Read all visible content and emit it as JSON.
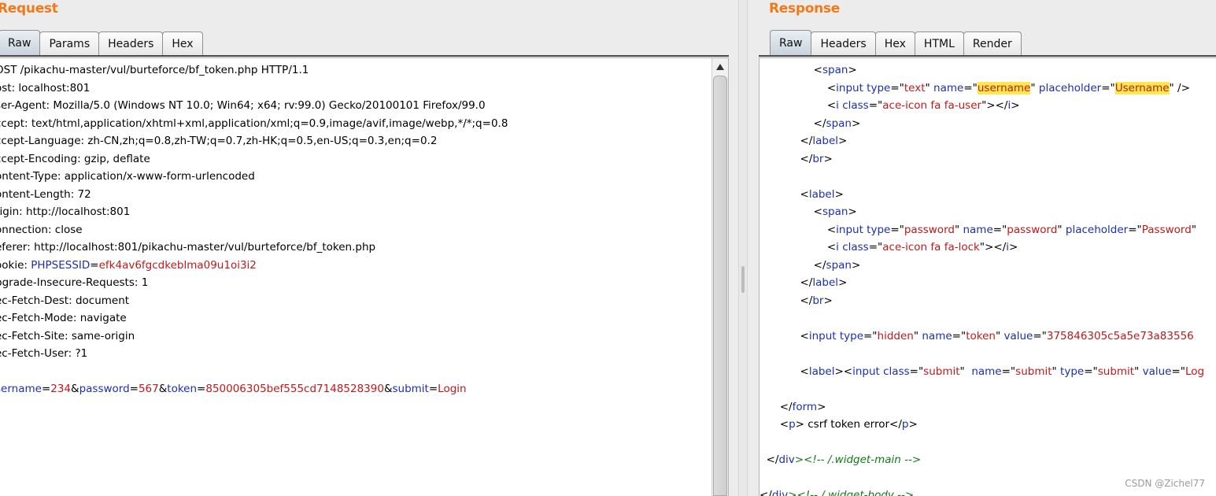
{
  "request": {
    "title": "Request",
    "tabs": [
      {
        "label": "Raw",
        "active": true
      },
      {
        "label": "Params",
        "active": false
      },
      {
        "label": "Headers",
        "active": false
      },
      {
        "label": "Hex",
        "active": false
      }
    ],
    "lines": [
      [
        {
          "t": "OST /pikachu-master/vul/burteforce/bf_token.php HTTP/1.1",
          "c": "k"
        }
      ],
      [
        {
          "t": "ost: localhost:801",
          "c": "k"
        }
      ],
      [
        {
          "t": "ser-Agent: Mozilla/5.0 (Windows NT 10.0; Win64; x64; rv:99.0) Gecko/20100101 Firefox/99.0",
          "c": "k"
        }
      ],
      [
        {
          "t": "ccept: text/html,application/xhtml+xml,application/xml;q=0.9,image/avif,image/webp,*/*;q=0.8",
          "c": "k"
        }
      ],
      [
        {
          "t": "ccept-Language: zh-CN,zh;q=0.8,zh-TW;q=0.7,zh-HK;q=0.5,en-US;q=0.3,en;q=0.2",
          "c": "k"
        }
      ],
      [
        {
          "t": "ccept-Encoding: gzip, deflate",
          "c": "k"
        }
      ],
      [
        {
          "t": "ontent-Type: application/x-www-form-urlencoded",
          "c": "k"
        }
      ],
      [
        {
          "t": "ontent-Length: 72",
          "c": "k"
        }
      ],
      [
        {
          "t": "rigin: http://localhost:801",
          "c": "k"
        }
      ],
      [
        {
          "t": "onnection: close",
          "c": "k"
        }
      ],
      [
        {
          "t": "eferer: http://localhost:801/pikachu-master/vul/burteforce/bf_token.php",
          "c": "k"
        }
      ],
      [
        {
          "t": "ookie: ",
          "c": "k"
        },
        {
          "t": "PHPSESSID",
          "c": "n"
        },
        {
          "t": "=",
          "c": "k"
        },
        {
          "t": "efk4av6fgcdkeblma09u1oi3i2",
          "c": "v"
        }
      ],
      [
        {
          "t": "pgrade-Insecure-Requests: 1",
          "c": "k"
        }
      ],
      [
        {
          "t": "ec-Fetch-Dest: document",
          "c": "k"
        }
      ],
      [
        {
          "t": "ec-Fetch-Mode: navigate",
          "c": "k"
        }
      ],
      [
        {
          "t": "ec-Fetch-Site: same-origin",
          "c": "k"
        }
      ],
      [
        {
          "t": "ec-Fetch-User: ?1",
          "c": "k"
        }
      ],
      [],
      [
        {
          "t": "sername",
          "c": "n"
        },
        {
          "t": "=",
          "c": "k"
        },
        {
          "t": "234",
          "c": "v"
        },
        {
          "t": "&",
          "c": "k"
        },
        {
          "t": "password",
          "c": "n"
        },
        {
          "t": "=",
          "c": "k"
        },
        {
          "t": "567",
          "c": "v"
        },
        {
          "t": "&",
          "c": "k"
        },
        {
          "t": "token",
          "c": "n"
        },
        {
          "t": "=",
          "c": "k"
        },
        {
          "t": "850006305bef555cd7148528390",
          "c": "v"
        },
        {
          "t": "&",
          "c": "k"
        },
        {
          "t": "submit",
          "c": "n"
        },
        {
          "t": "=",
          "c": "k"
        },
        {
          "t": "Login",
          "c": "v"
        }
      ]
    ]
  },
  "response": {
    "title": "Response",
    "tabs": [
      {
        "label": "Raw",
        "active": true
      },
      {
        "label": "Headers",
        "active": false
      },
      {
        "label": "Hex",
        "active": false
      },
      {
        "label": "HTML",
        "active": false
      },
      {
        "label": "Render",
        "active": false
      }
    ],
    "lines": [
      [
        {
          "t": "                <",
          "c": "k"
        },
        {
          "t": "span",
          "c": "t"
        },
        {
          "t": ">",
          "c": "k"
        }
      ],
      [
        {
          "t": "                    <",
          "c": "k"
        },
        {
          "t": "input",
          "c": "t"
        },
        {
          "t": " type",
          "c": "a"
        },
        {
          "t": "=\"",
          "c": "k"
        },
        {
          "t": "text",
          "c": "s"
        },
        {
          "t": "\" ",
          "c": "k"
        },
        {
          "t": "name",
          "c": "a"
        },
        {
          "t": "=\"",
          "c": "k"
        },
        {
          "t": "username",
          "c": "s",
          "hl": true
        },
        {
          "t": "\" ",
          "c": "k"
        },
        {
          "t": "placeholder",
          "c": "a"
        },
        {
          "t": "=\"",
          "c": "k"
        },
        {
          "t": "Username",
          "c": "s",
          "hl": true
        },
        {
          "t": "\" />",
          "c": "k"
        }
      ],
      [
        {
          "t": "                    <",
          "c": "k"
        },
        {
          "t": "i",
          "c": "t"
        },
        {
          "t": " class",
          "c": "a"
        },
        {
          "t": "=\"",
          "c": "k"
        },
        {
          "t": "ace-icon fa fa-user",
          "c": "s"
        },
        {
          "t": "\"></",
          "c": "k"
        },
        {
          "t": "i",
          "c": "t"
        },
        {
          "t": ">",
          "c": "k"
        }
      ],
      [
        {
          "t": "                </",
          "c": "k"
        },
        {
          "t": "span",
          "c": "t"
        },
        {
          "t": ">",
          "c": "k"
        }
      ],
      [
        {
          "t": "            </",
          "c": "k"
        },
        {
          "t": "label",
          "c": "t"
        },
        {
          "t": ">",
          "c": "k"
        }
      ],
      [
        {
          "t": "            </",
          "c": "k"
        },
        {
          "t": "br",
          "c": "t"
        },
        {
          "t": ">",
          "c": "k"
        }
      ],
      [],
      [
        {
          "t": "            <",
          "c": "k"
        },
        {
          "t": "label",
          "c": "t"
        },
        {
          "t": ">",
          "c": "k"
        }
      ],
      [
        {
          "t": "                <",
          "c": "k"
        },
        {
          "t": "span",
          "c": "t"
        },
        {
          "t": ">",
          "c": "k"
        }
      ],
      [
        {
          "t": "                    <",
          "c": "k"
        },
        {
          "t": "input",
          "c": "t"
        },
        {
          "t": " type",
          "c": "a"
        },
        {
          "t": "=\"",
          "c": "k"
        },
        {
          "t": "password",
          "c": "s"
        },
        {
          "t": "\" ",
          "c": "k"
        },
        {
          "t": "name",
          "c": "a"
        },
        {
          "t": "=\"",
          "c": "k"
        },
        {
          "t": "password",
          "c": "s"
        },
        {
          "t": "\" ",
          "c": "k"
        },
        {
          "t": "placeholder",
          "c": "a"
        },
        {
          "t": "=\"",
          "c": "k"
        },
        {
          "t": "Password",
          "c": "s"
        },
        {
          "t": "\"",
          "c": "k"
        }
      ],
      [
        {
          "t": "                    <",
          "c": "k"
        },
        {
          "t": "i",
          "c": "t"
        },
        {
          "t": " class",
          "c": "a"
        },
        {
          "t": "=\"",
          "c": "k"
        },
        {
          "t": "ace-icon fa fa-lock",
          "c": "s"
        },
        {
          "t": "\"></",
          "c": "k"
        },
        {
          "t": "i",
          "c": "t"
        },
        {
          "t": ">",
          "c": "k"
        }
      ],
      [
        {
          "t": "                </",
          "c": "k"
        },
        {
          "t": "span",
          "c": "t"
        },
        {
          "t": ">",
          "c": "k"
        }
      ],
      [
        {
          "t": "            </",
          "c": "k"
        },
        {
          "t": "label",
          "c": "t"
        },
        {
          "t": ">",
          "c": "k"
        }
      ],
      [
        {
          "t": "            </",
          "c": "k"
        },
        {
          "t": "br",
          "c": "t"
        },
        {
          "t": ">",
          "c": "k"
        }
      ],
      [],
      [
        {
          "t": "            <",
          "c": "k"
        },
        {
          "t": "input",
          "c": "t"
        },
        {
          "t": " type",
          "c": "a"
        },
        {
          "t": "=\"",
          "c": "k"
        },
        {
          "t": "hidden",
          "c": "s"
        },
        {
          "t": "\" ",
          "c": "k"
        },
        {
          "t": "name",
          "c": "a"
        },
        {
          "t": "=\"",
          "c": "k"
        },
        {
          "t": "token",
          "c": "s"
        },
        {
          "t": "\" ",
          "c": "k"
        },
        {
          "t": "value",
          "c": "a"
        },
        {
          "t": "=\"",
          "c": "k"
        },
        {
          "t": "375846305c5a5e73a83556",
          "c": "s"
        }
      ],
      [],
      [
        {
          "t": "            <",
          "c": "k"
        },
        {
          "t": "label",
          "c": "t"
        },
        {
          "t": "><",
          "c": "k"
        },
        {
          "t": "input",
          "c": "t"
        },
        {
          "t": " class",
          "c": "a"
        },
        {
          "t": "=\"",
          "c": "k"
        },
        {
          "t": "submit",
          "c": "s"
        },
        {
          "t": "\"  ",
          "c": "k"
        },
        {
          "t": "name",
          "c": "a"
        },
        {
          "t": "=\"",
          "c": "k"
        },
        {
          "t": "submit",
          "c": "s"
        },
        {
          "t": "\" ",
          "c": "k"
        },
        {
          "t": "type",
          "c": "a"
        },
        {
          "t": "=\"",
          "c": "k"
        },
        {
          "t": "submit",
          "c": "s"
        },
        {
          "t": "\" ",
          "c": "k"
        },
        {
          "t": "value",
          "c": "a"
        },
        {
          "t": "=\"",
          "c": "k"
        },
        {
          "t": "Log",
          "c": "s"
        }
      ],
      [],
      [
        {
          "t": "      </",
          "c": "k"
        },
        {
          "t": "form",
          "c": "t"
        },
        {
          "t": ">",
          "c": "k"
        }
      ],
      [
        {
          "t": "      <",
          "c": "k"
        },
        {
          "t": "p",
          "c": "t"
        },
        {
          "t": "> csrf token error</",
          "c": "k"
        },
        {
          "t": "p",
          "c": "t"
        },
        {
          "t": ">",
          "c": "k"
        }
      ],
      [],
      [
        {
          "t": "  </",
          "c": "k"
        },
        {
          "t": "div",
          "c": "t"
        },
        {
          "t": "><!-- /.widget-main -->",
          "c": "c"
        }
      ],
      [],
      [
        {
          "t": "</",
          "c": "k"
        },
        {
          "t": "div",
          "c": "t"
        },
        {
          "t": "><!-- /.widget-body -->",
          "c": "c"
        }
      ]
    ]
  },
  "watermark": "CSDN @Zichel77"
}
